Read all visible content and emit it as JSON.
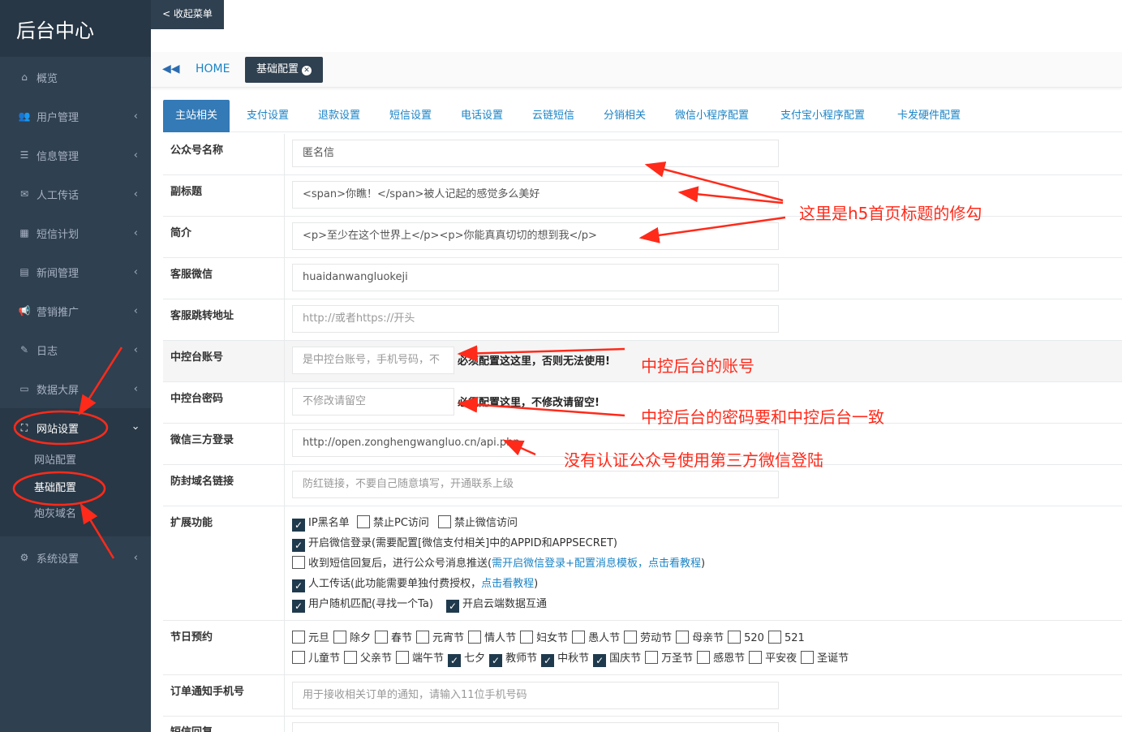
{
  "sidebar": {
    "title": "后台中心",
    "items": [
      {
        "label": "概览",
        "icon": "home-icon",
        "chev": false
      },
      {
        "label": "用户管理",
        "icon": "users-icon",
        "chev": true
      },
      {
        "label": "信息管理",
        "icon": "list-icon",
        "chev": true
      },
      {
        "label": "人工传话",
        "icon": "envelope-icon",
        "chev": true
      },
      {
        "label": "短信计划",
        "icon": "calendar-icon",
        "chev": true
      },
      {
        "label": "新闻管理",
        "icon": "newspaper-icon",
        "chev": true
      },
      {
        "label": "营销推广",
        "icon": "bullhorn-icon",
        "chev": true
      },
      {
        "label": "日志",
        "icon": "edit-icon",
        "chev": true
      },
      {
        "label": "数据大屏",
        "icon": "screen-icon",
        "chev": true
      },
      {
        "label": "网站设置",
        "icon": "sitemap-icon",
        "chev": true
      },
      {
        "label": "系统设置",
        "icon": "gear-icon",
        "chev": true
      }
    ],
    "sub_items": [
      "网站配置",
      "基础配置",
      "炮灰域名"
    ]
  },
  "topbar": {
    "collapse": "< 收起菜单",
    "home": "HOME",
    "current_tab": "基础配置"
  },
  "config_tabs": [
    "主站相关",
    "支付设置",
    "退款设置",
    "短信设置",
    "电话设置",
    "云链短信",
    "分销相关",
    "微信小程序配置",
    "支付宝小程序配置",
    "卡发硬件配置"
  ],
  "form": {
    "public_name": {
      "label": "公众号名称",
      "value": "匿名信"
    },
    "subtitle": {
      "label": "副标题",
      "value": "<span>你瞧！</span>被人记起的感觉多么美好"
    },
    "intro": {
      "label": "简介",
      "value": "<p>至少在这个世界上</p><p>你能真真切切的想到我</p>"
    },
    "service_wechat": {
      "label": "客服微信",
      "value": "huaidanwangluokeji"
    },
    "service_url": {
      "label": "客服跳转地址",
      "placeholder": "http://或者https://开头"
    },
    "ctrl_account": {
      "label": "中控台账号",
      "placeholder": "是中控台账号，手机号码，不",
      "hint": "必须配置这这里，否则无法使用!"
    },
    "ctrl_password": {
      "label": "中控台密码",
      "placeholder": "不修改请留空",
      "hint": "必须配置这里，不修改请留空!"
    },
    "wechat_login": {
      "label": "微信三方登录",
      "value": "http://open.zonghengwangluo.cn/api.php"
    },
    "anti_block": {
      "label": "防封域名链接",
      "placeholder": "防红链接，不要自己随意填写，开通联系上级"
    },
    "ext": {
      "label": "扩展功能",
      "ip_black": "IP黑名单",
      "no_pc": "禁止PC访问",
      "no_wechat": "禁止微信访问",
      "wx_login": "开启微信登录(需要配置[微信支付相关]中的APPID和APPSECRET)",
      "sms_reply_a": "收到短信回复后，进行公众号消息推送(",
      "sms_reply_link": "需开启微信登录+配置消息模板，点击看教程",
      "sms_reply_b": ")",
      "manual_a": "人工传话(此功能需要单独付费授权，",
      "manual_link": "点击看教程",
      "manual_b": ")",
      "random_match": "用户随机匹配(寻找一个Ta)",
      "cloud_sync": "开启云端数据互通"
    },
    "holiday": {
      "label": "节日预约",
      "row1": [
        {
          "name": "元旦",
          "checked": false
        },
        {
          "name": "除夕",
          "checked": false
        },
        {
          "name": "春节",
          "checked": false
        },
        {
          "name": "元宵节",
          "checked": false
        },
        {
          "name": "情人节",
          "checked": false
        },
        {
          "name": "妇女节",
          "checked": false
        },
        {
          "name": "愚人节",
          "checked": false
        },
        {
          "name": "劳动节",
          "checked": false
        },
        {
          "name": "母亲节",
          "checked": false
        },
        {
          "name": "520",
          "checked": false
        },
        {
          "name": "521",
          "checked": false
        }
      ],
      "row2": [
        {
          "name": "儿童节",
          "checked": false
        },
        {
          "name": "父亲节",
          "checked": false
        },
        {
          "name": "端午节",
          "checked": false
        },
        {
          "name": "七夕",
          "checked": true
        },
        {
          "name": "教师节",
          "checked": true
        },
        {
          "name": "中秋节",
          "checked": true
        },
        {
          "name": "国庆节",
          "checked": true
        },
        {
          "name": "万圣节",
          "checked": false
        },
        {
          "name": "感恩节",
          "checked": false
        },
        {
          "name": "平安夜",
          "checked": false
        },
        {
          "name": "圣诞节",
          "checked": false
        }
      ]
    },
    "order_phone": {
      "label": "订单通知手机号",
      "placeholder": "用于接收相关订单的通知，请输入11位手机号码"
    },
    "sms_reply": {
      "label": "短信回复"
    }
  },
  "annotations": {
    "h5_title": "这里是h5首页标题的修勾",
    "ctrl_account": "中控后台的账号",
    "ctrl_password": "中控后台的密码要和中控后台一致",
    "wechat_login": "没有认证公众号使用第三方微信登陆"
  },
  "colors": {
    "sidebar": "#2f4050",
    "accent": "#337ab7",
    "annotation": "#ff2a1a"
  }
}
